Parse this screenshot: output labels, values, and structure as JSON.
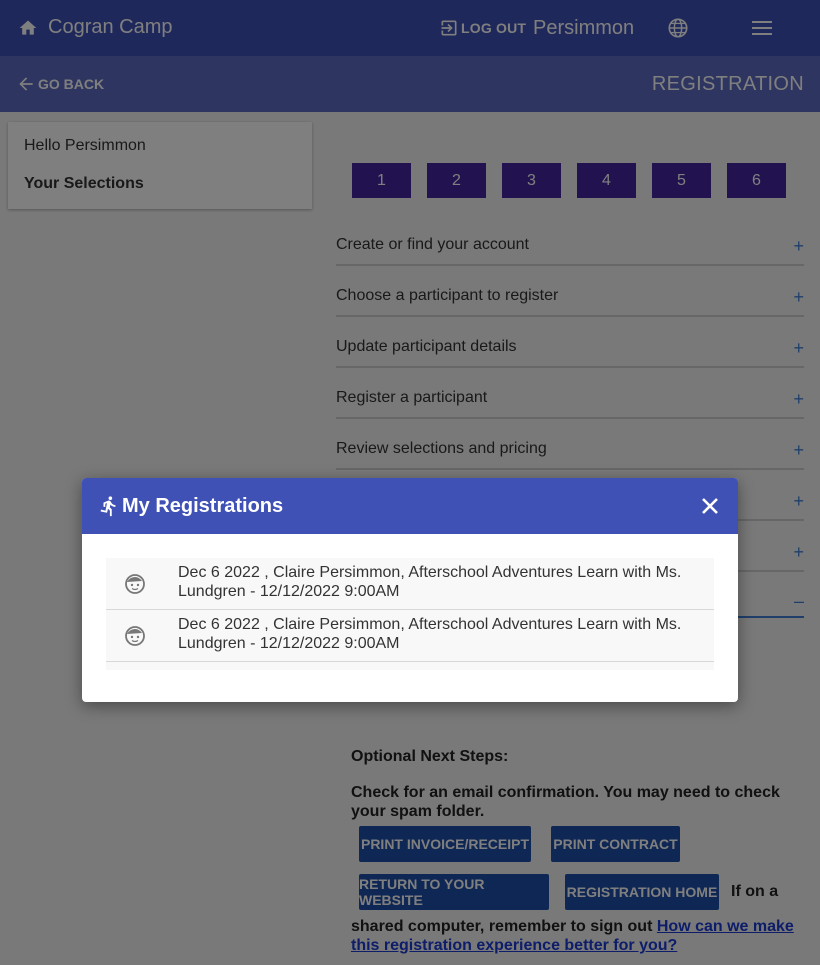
{
  "header": {
    "app_title": "Cogran Camp",
    "logout_label": "LOG OUT",
    "user_name": "Persimmon",
    "icons": [
      "home-icon",
      "logout-icon",
      "globe-icon",
      "menu-icon"
    ]
  },
  "subheader": {
    "go_back_label": "GO BACK",
    "page_title": "REGISTRATION"
  },
  "sidebar": {
    "greeting": "Hello Persimmon",
    "selections_label": "Your Selections"
  },
  "steps": [
    "1",
    "2",
    "3",
    "4",
    "5",
    "6"
  ],
  "sections": [
    {
      "label": "Create or find your account",
      "toggle": "+"
    },
    {
      "label": "Choose a participant to register",
      "toggle": "+"
    },
    {
      "label": "Update participant details",
      "toggle": "+"
    },
    {
      "label": "Register a participant",
      "toggle": "+"
    },
    {
      "label": "Review selections and pricing",
      "toggle": "+"
    },
    {
      "label": "",
      "toggle": "+"
    },
    {
      "label": "",
      "toggle": "+"
    },
    {
      "label": "",
      "toggle": "–"
    }
  ],
  "next_steps": {
    "heading": "Optional Next Steps:",
    "email_note": "Check for an email confirmation. You may need to check your spam folder.",
    "print_invoice_label": "PRINT INVOICE/RECEIPT",
    "print_contract_label": "PRINT CONTRACT",
    "return_website_label": "RETURN TO YOUR WEBSITE",
    "registration_home_label": "REGISTRATION HOME",
    "shared_note_part1": "If on a",
    "shared_note_part2": "shared computer, remember to sign out",
    "feedback_link": "How can we make this registration experience better for you?"
  },
  "modal": {
    "title": "My Registrations",
    "registrations": [
      {
        "text": "Dec 6 2022 , Claire Persimmon, Afterschool Adventures Learn with Ms. Lundgren - 12/12/2022 9:00AM"
      },
      {
        "text": "Dec 6 2022 , Claire Persimmon, Afterschool Adventures Learn with Ms. Lundgren - 12/12/2022 9:00AM"
      }
    ]
  },
  "colors": {
    "primary": "#3f51b5",
    "secondary": "#5c6bc0",
    "step": "#4527a0",
    "button": "#1e4fa8",
    "link": "#1a3bd4"
  }
}
